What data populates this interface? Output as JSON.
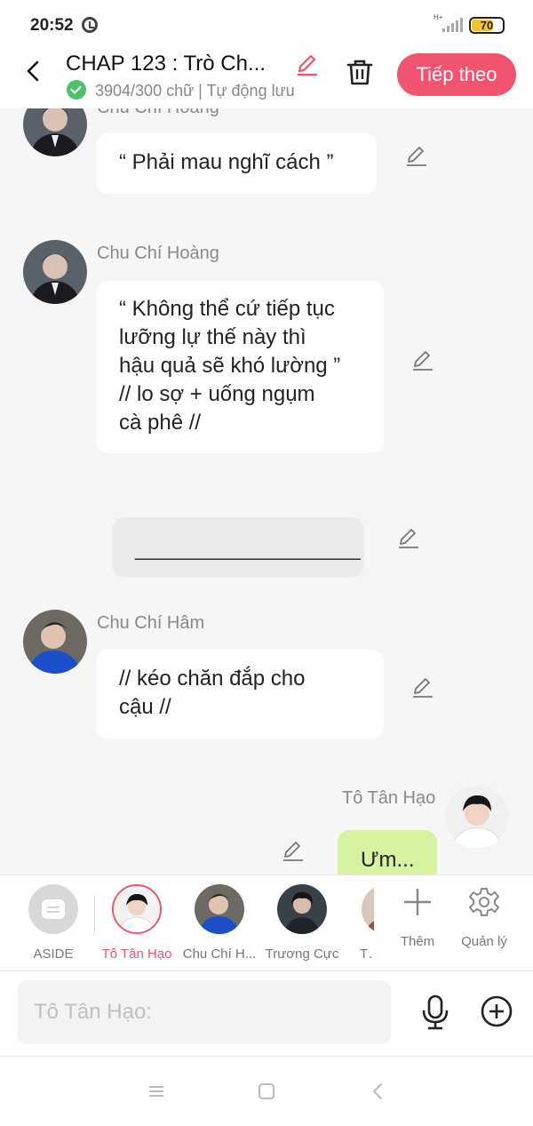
{
  "status": {
    "time": "20:52",
    "network": "H+",
    "battery": "70",
    "battery_level": 0.7
  },
  "header": {
    "title": "CHAP 123 : Trò Ch...",
    "word_count": "3904/300 chữ | Tự động lưu",
    "next_label": "Tiếp theo"
  },
  "messages": [
    {
      "speaker": "Chu Chí Hoàng",
      "text": "“ Phải mau nghĩ cách ”"
    },
    {
      "speaker": "Chu Chí Hoàng",
      "lines": [
        "“ Không thể cứ tiếp tục",
        "lưỡng lự thế này thì",
        "hậu quả sẽ khó lường ”",
        "// lo sợ + uống ngụm",
        "cà phê //"
      ]
    },
    {
      "speaker": "",
      "text": "___________________"
    },
    {
      "speaker": "Chu Chí Hâm",
      "lines": [
        "// kéo chăn đắp cho",
        "cậu //"
      ]
    },
    {
      "speaker": "Tô Tân Hạo",
      "text": "Ưm..."
    }
  ],
  "characters": [
    {
      "name": "ASIDE",
      "active": false
    },
    {
      "name": "Tô Tân Hạo",
      "active": true
    },
    {
      "name": "Chu Chí H...",
      "active": false
    },
    {
      "name": "Trương Cực",
      "active": false
    },
    {
      "name": "Tả",
      "active": false
    }
  ],
  "tools": {
    "add_label": "Thêm",
    "manage_label": "Quản lý"
  },
  "input": {
    "placeholder": "Tô Tân Hạo:",
    "value": ""
  },
  "colors": {
    "accent": "#f2536e",
    "me_bubble": "#d7f2a0",
    "check_green": "#4cc36a",
    "battery": "#f2c432"
  },
  "icons": [
    "back-icon",
    "pencil-icon",
    "trash-icon",
    "check-icon",
    "edit-icon",
    "aside-icon",
    "plus-icon",
    "gear-icon",
    "mic-icon",
    "plus-circle-icon",
    "menu-icon",
    "home-icon",
    "back-nav-icon"
  ]
}
